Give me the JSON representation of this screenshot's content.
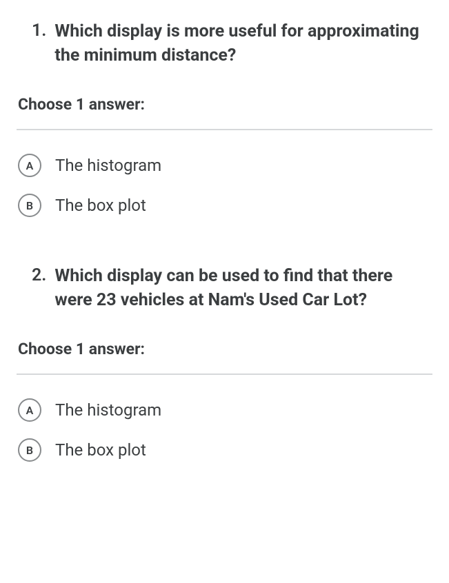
{
  "questions": [
    {
      "number": "1.",
      "text": "Which display is more useful for approximating the minimum distance?",
      "instruction": "Choose 1 answer:",
      "options": [
        {
          "letter": "A",
          "label": "The histogram"
        },
        {
          "letter": "B",
          "label": "The box plot"
        }
      ]
    },
    {
      "number": "2.",
      "text": "Which display can be used to find that there were 23 vehicles at Nam's Used Car Lot?",
      "instruction": "Choose 1 answer:",
      "options": [
        {
          "letter": "A",
          "label": "The histogram"
        },
        {
          "letter": "B",
          "label": "The box plot"
        }
      ]
    }
  ]
}
